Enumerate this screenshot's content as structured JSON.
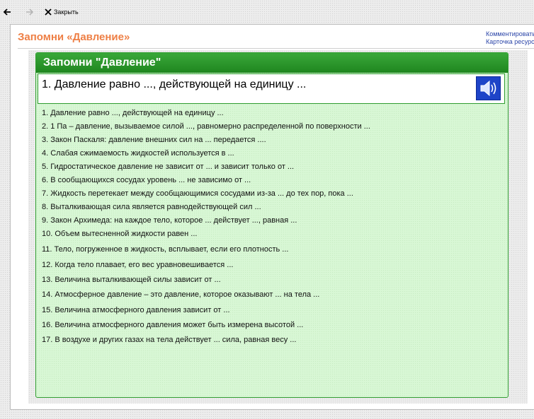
{
  "toolbar": {
    "back_icon": "arrow-left-icon",
    "forward_icon": "arrow-right-icon",
    "close_label": "Закрыть"
  },
  "page": {
    "title": "Запомни «Давление»",
    "links": [
      "Комментировать",
      "Карточка ресурса"
    ]
  },
  "panel": {
    "header": "Запомни \"Давление\"",
    "current_question": "1. Давление равно ..., действующей на единицу ...",
    "sound_icon": "speaker-icon",
    "items": [
      "1. Давление равно ..., действующей на единицу ...",
      "2. 1 Па – давление, вызываемое силой ..., равномерно распределенной по поверхности ...",
      "3. Закон Паскаля: давление внешних сил на ... передается ....",
      "4. Слабая сжимаемость жидкостей используется в ...",
      "5. Гидростатическое давление не зависит от ... и зависит только от ...",
      "6. В сообщающихся сосудах уровень ... не зависимо от ...",
      "7. Жидкость перетекает между сообщающимися сосудами из-за ... до тех пор, пока ...",
      "8. Выталкивающая сила является равнодействующей сил ...",
      "9. Закон Архимеда: на каждое тело, которое ... действует ..., равная ...",
      "10. Объем вытесненной жидкости равен ...",
      "11. Тело, погруженное в жидкость, всплывает, если его плотность ...",
      "12. Когда тело плавает, его вес уравновешивается ...",
      "13. Величина выталкивающей силы зависит от ...",
      "14. Атмосферное давление – это давление, которое оказывают ... на тела ...",
      "15. Величина атмосферного давления зависит от ...",
      "16. Величина атмосферного давления может быть измерена высотой ...",
      "17. В воздухе и других газах на тела действует ... сила, равная весу ..."
    ]
  },
  "colors": {
    "title_orange": "#ee7f45",
    "panel_green": "#2f9c2f",
    "panel_bg": "#d8f7d5",
    "speaker_blue": "#1e44c8",
    "link_blue": "#2b45a8"
  }
}
